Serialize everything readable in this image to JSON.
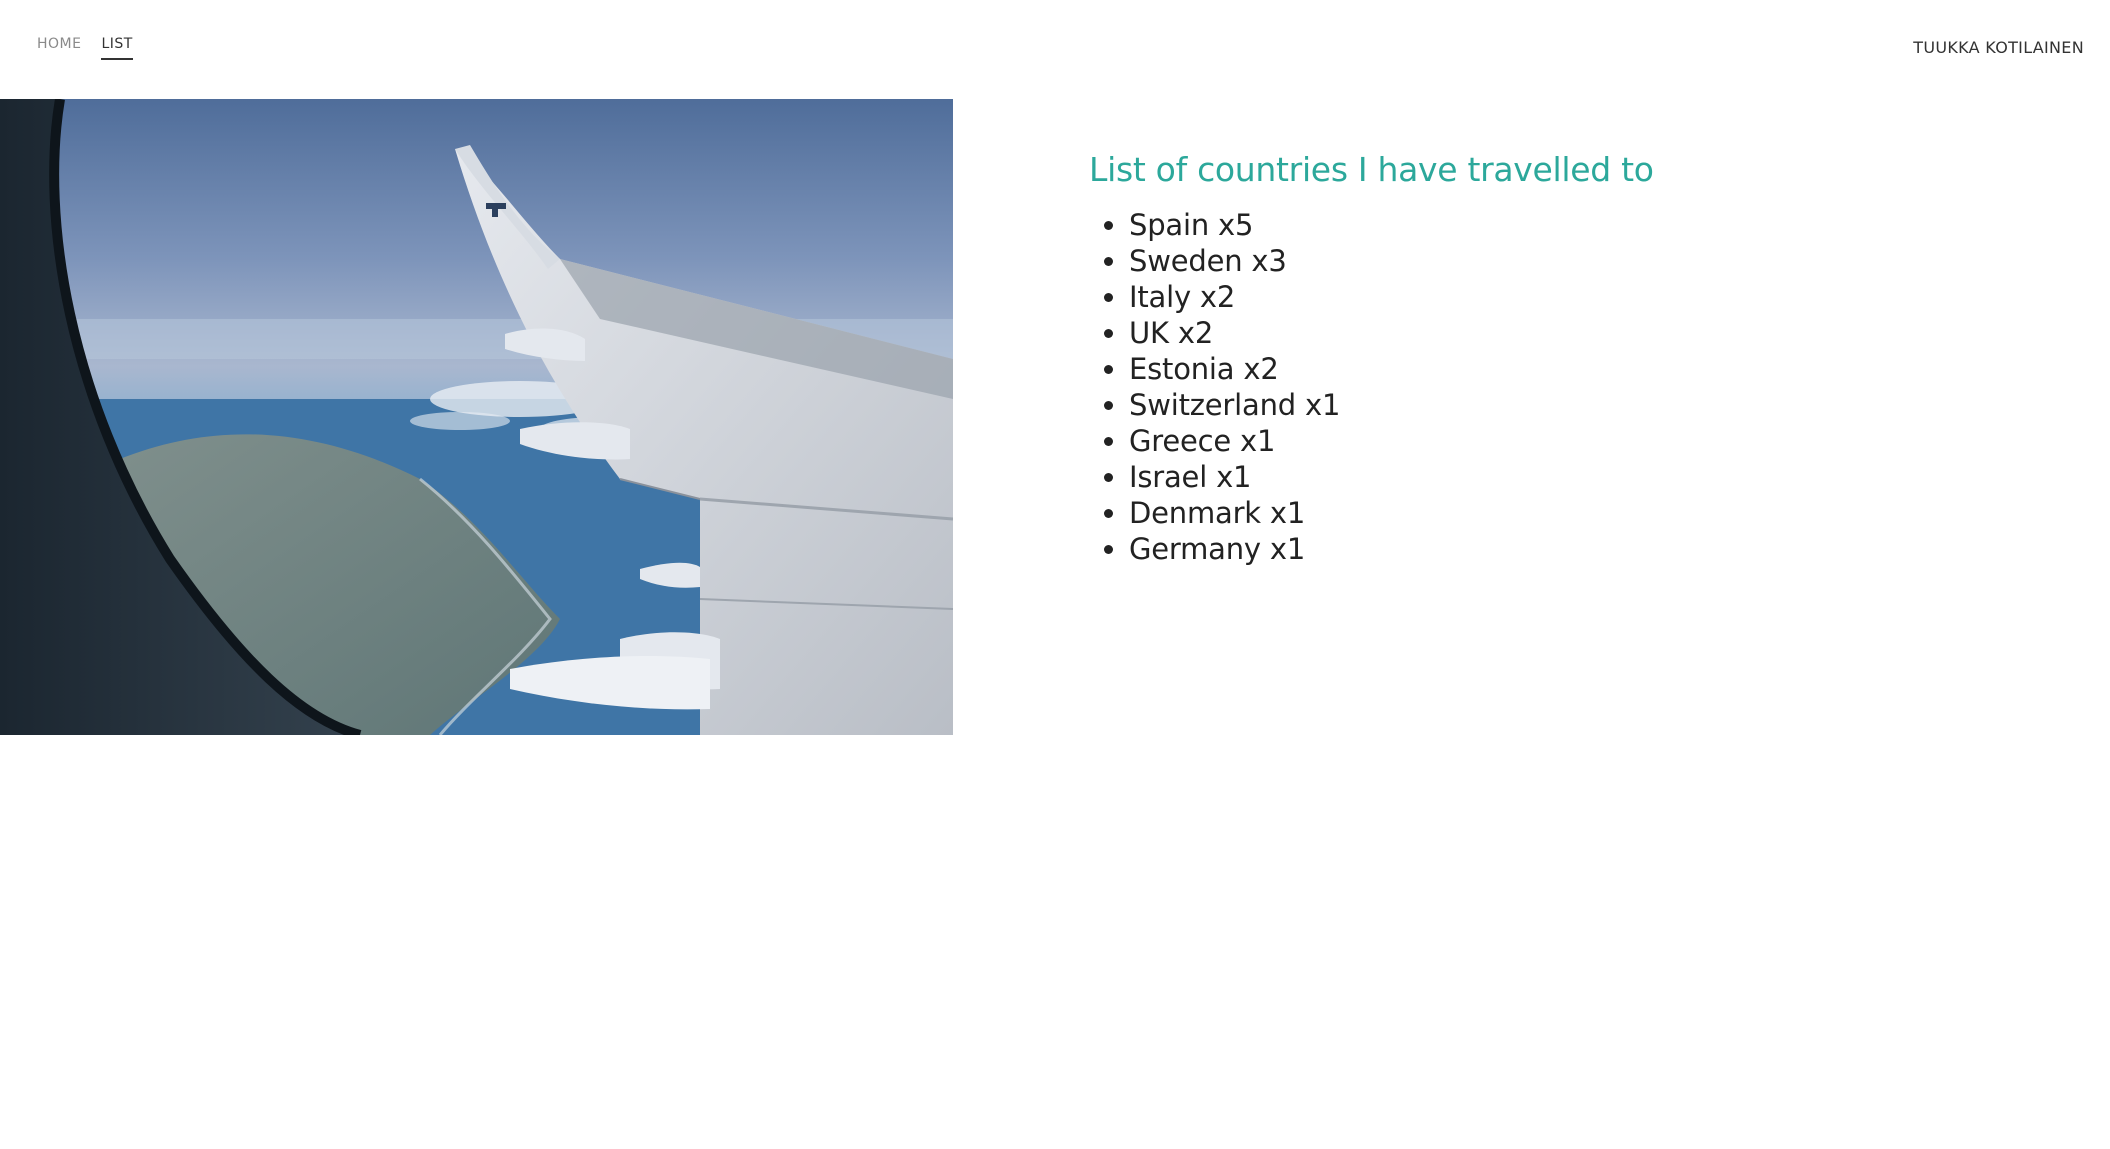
{
  "nav": {
    "items": [
      {
        "label": "HOME"
      },
      {
        "label": "LIST"
      }
    ],
    "active": "LIST"
  },
  "site_owner": "TUUKKA KOTILAINEN",
  "hero_image": {
    "subject": "airplane-wing-through-window"
  },
  "main": {
    "heading": "List of countries I have travelled to",
    "countries": [
      "Spain x5",
      "Sweden x3",
      "Italy x2",
      "UK x2",
      "Estonia x2",
      "Switzerland x1",
      "Greece x1",
      "Israel x1",
      "Denmark x1",
      "Germany x1"
    ]
  },
  "colors": {
    "heading": "#2ca89b",
    "text": "#222222",
    "nav_inactive": "#8a8a8a"
  }
}
